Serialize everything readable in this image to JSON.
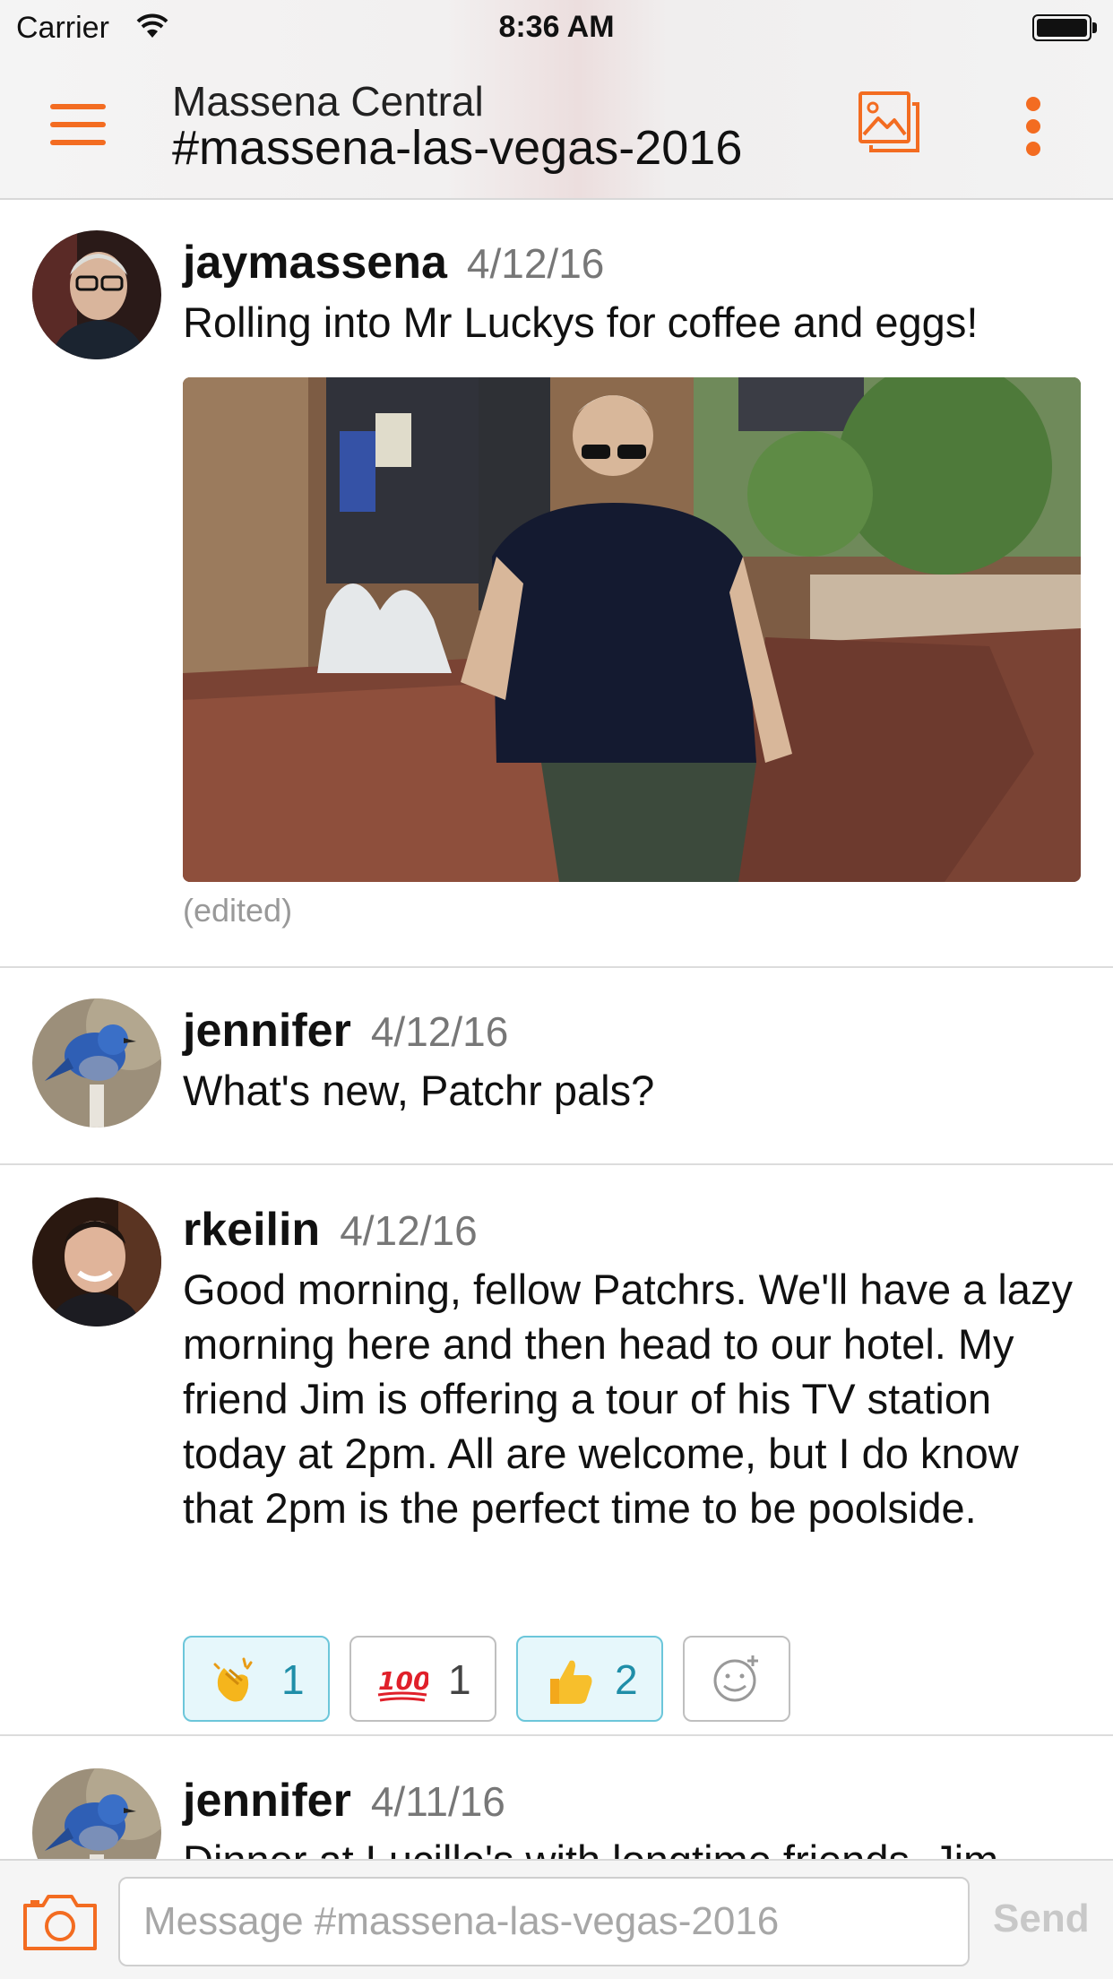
{
  "status_bar": {
    "carrier": "Carrier",
    "time": "8:36 AM"
  },
  "header": {
    "org_name": "Massena Central",
    "channel_name": "#massena-las-vegas-2016",
    "menu_icon": "hamburger-menu-icon",
    "photos_icon": "photo-gallery-icon",
    "more_icon": "vertical-dots-icon"
  },
  "colors": {
    "accent": "#f36c21",
    "reaction_active_bg": "#e6f7fb",
    "reaction_active_border": "#6cc6da"
  },
  "messages": [
    {
      "author": "jaymassena",
      "date": "4/12/16",
      "text": "Rolling into Mr Luckys for coffee and eggs!",
      "has_photo": true,
      "edited_label": "(edited)"
    },
    {
      "author": "jennifer",
      "date": "4/12/16",
      "text": "What's new, Patchr pals?"
    },
    {
      "author": "rkeilin",
      "date": "4/12/16",
      "text": "Good morning, fellow Patchrs. We'll have a lazy morning here and then head to our hotel. My friend Jim is offering a tour of his TV station today at 2pm. All are welcome, but I do know that 2pm is the perfect time to be poolside.",
      "reactions": [
        {
          "emoji": "clapping-hands",
          "count": "1",
          "mine": true
        },
        {
          "emoji": "hundred-points",
          "count": "1",
          "mine": false
        },
        {
          "emoji": "thumbs-up",
          "count": "2",
          "mine": true
        }
      ]
    },
    {
      "author": "jennifer",
      "date": "4/11/16",
      "text": "Dinner at Lucille's with longtime friends, Jim"
    }
  ],
  "composer": {
    "placeholder": "Message #massena-las-vegas-2016",
    "send_label": "Send",
    "camera_icon": "camera-icon"
  }
}
